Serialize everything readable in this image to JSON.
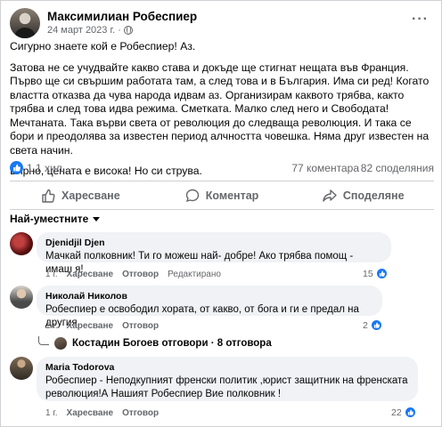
{
  "post": {
    "author": "Максимилиан Робеспиер",
    "date": "24 март 2023 г.",
    "date_sep": "·",
    "paragraphs": [
      "Сигурно знаете кой е Робеспиер! Аз.",
      "Затова не се учудвайте какво става и докъде ще стигнат нещата във Франция. Първо ще си свършим работата там, а след това и в България. Има си ред! Когато властта отказва да чува народа идвам аз. Организирам каквото трябва, както трябва и след това идва режима. Сметката. Малко след него и Свободата! Мечтаната. Така върви света от революция до следваща революция. И така се бори и преодолява за известен период алчността човешка. Няма друг известен на света начин.",
      "Вярно, цената е висока! Но си струва."
    ],
    "reactions_count": "1,1 хил.",
    "comments_count": "77 коментара",
    "shares_count": "82 споделяния"
  },
  "actions": {
    "like": "Харесване",
    "comment": "Коментар",
    "share": "Споделяне"
  },
  "filter": {
    "label": "Най-уместните"
  },
  "comments": [
    {
      "name": "Djenidjil Djen",
      "text": "Мачкай полковник! Ти го можеш най- добре! Ако трябва помощ - имаш я!",
      "time": "1 г.",
      "like": "Харесване",
      "reply": "Отговор",
      "edited": "Редактирано",
      "reactions": "15"
    },
    {
      "name": "Николай Николов",
      "text": "Робеспиер е освободил хората, от какво, от бога и ги е предал на другия.",
      "time": "1 г.",
      "like": "Харесване",
      "reply": "Отговор",
      "reactions": "2"
    },
    {
      "name": "Maria Todorova",
      "text_line1": "Робеспиер - Неподкупният френски политик ,юрист защитник на френската",
      "text_line2": "революция!А Нашият Робеспиер Вие полковник !",
      "time": "1 г.",
      "like": "Харесване",
      "reply": "Отговор",
      "reactions": "22"
    }
  ],
  "replies_summary": "Костадин Богоев отговори · 8 отговора",
  "colors": {
    "accent": "#1877f2",
    "bubble": "#f0f2f5",
    "muted": "#65676b"
  },
  "icons": [
    "globe-icon",
    "more-icon",
    "like-icon",
    "comment-icon",
    "share-icon",
    "chevron-down-icon"
  ]
}
